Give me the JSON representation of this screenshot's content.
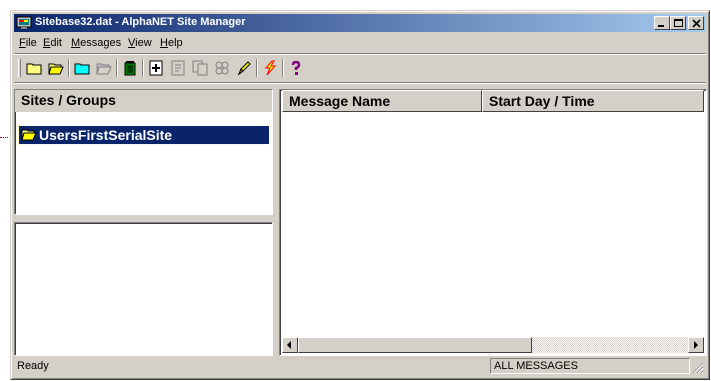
{
  "window": {
    "title": "Sitebase32.dat - AlphaNET Site Manager"
  },
  "menu": [
    "File",
    "Edit",
    "Messages",
    "View",
    "Help"
  ],
  "menu_mnemonics": [
    "F",
    "E",
    "M",
    "V",
    "H"
  ],
  "toolbar": {
    "icons": [
      "new-folder-icon",
      "open-folder-icon",
      "new-site-icon",
      "open-site-icon",
      "delete-trash-icon",
      "add-message-icon",
      "edit-message-icon",
      "copy-message-icon",
      "network-icon",
      "edit-pencil-icon",
      "send-lightning-icon",
      "help-question-icon"
    ]
  },
  "sites_panel": {
    "header": "Sites / Groups",
    "items": [
      {
        "label": "UsersFirstSerialSite",
        "selected": true
      }
    ]
  },
  "message_list": {
    "columns": [
      "Message Name",
      "Start Day / Time"
    ]
  },
  "status": {
    "left": "Ready",
    "right": "ALL MESSAGES"
  },
  "colors": {
    "title_start": "#0a246a",
    "title_end": "#a6caf0",
    "face": "#d4d0c8",
    "selection": "#0a246a"
  }
}
